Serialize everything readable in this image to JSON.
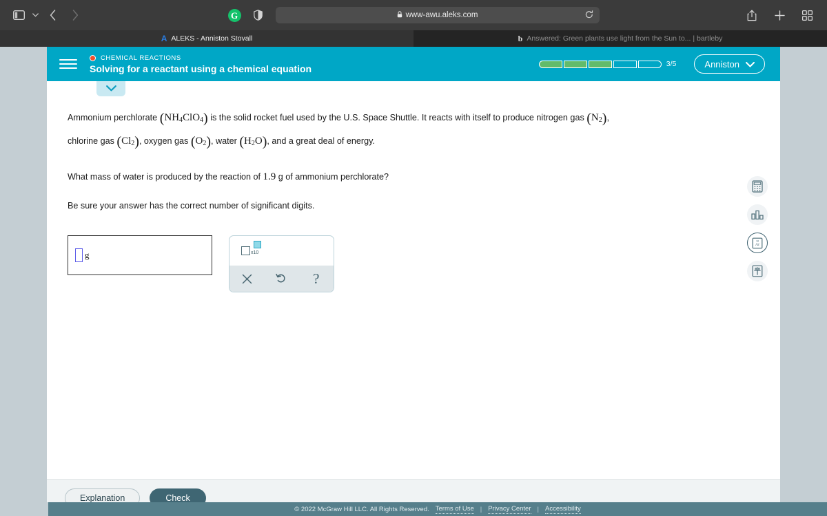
{
  "browser": {
    "url": "www-awu.aleks.com",
    "icons": {
      "sidebar": "sidebar-icon",
      "sidebar_chevron": "chevron-down-icon",
      "back": "back-arrow-icon",
      "forward": "forward-arrow-icon",
      "grammarly": "G",
      "shield": "shield-icon",
      "lock": "lock-icon",
      "reload": "reload-icon",
      "share": "share-icon",
      "new_tab": "plus-icon",
      "tab_overview": "grid-icon"
    },
    "tabs": [
      {
        "favicon": "A",
        "title": "ALEKS - Anniston Stovall",
        "active": true
      },
      {
        "favicon": "b",
        "title": "Answered: Green plants use light from the Sun to... | bartleby",
        "active": false
      }
    ]
  },
  "app_header": {
    "topic_label": "CHEMICAL REACTIONS",
    "lesson_title": "Solving for a reactant using a chemical equation",
    "progress": {
      "total": 5,
      "completed": 3,
      "count_text": "3/5"
    },
    "user_name": "Anniston",
    "user_chevron": "chevron-down-icon",
    "menu_icon": "hamburger-menu-icon",
    "collapse_icon": "chevron-down-icon",
    "accent_color": "#00a7c6",
    "topic_dot_color": "#f0502d",
    "progress_fill_color": "#62bb6a"
  },
  "question": {
    "paragraph1": {
      "part1": "Ammonium perchlorate ",
      "formula1_pre": "NH",
      "formula1_sub1": "4",
      "formula1_mid": "ClO",
      "formula1_sub2": "4",
      "part2": " is the solid rocket fuel used by the U.S. Space Shuttle. It reacts with itself to produce nitrogen gas ",
      "formula2_pre": "N",
      "formula2_sub": "2",
      "part3": ","
    },
    "paragraph2": {
      "part1": "chlorine gas ",
      "formula1_pre": "Cl",
      "formula1_sub": "2",
      "part2": ", oxygen gas ",
      "formula2_pre": "O",
      "formula2_sub": "2",
      "part3": ", water ",
      "formula3_pre": "H",
      "formula3_sub": "2",
      "formula3_post": "O",
      "part4": ", and a great deal of energy."
    },
    "paragraph3": {
      "part1": "What mass of water is produced by the reaction of ",
      "value": "1.9",
      "part2": " g of ammonium perchlorate?"
    },
    "paragraph4": "Be sure your answer has the correct number of significant digits."
  },
  "answer": {
    "input_value": "",
    "unit": "g",
    "blank_name": "answer-blank"
  },
  "math_pad": {
    "sci_notation": {
      "x10_label": "x10",
      "name": "scientific-notation-button"
    },
    "keys": [
      {
        "name": "clear-button",
        "glyph": "×"
      },
      {
        "name": "undo-button",
        "glyph": "undo-icon"
      },
      {
        "name": "help-button",
        "glyph": "?"
      }
    ]
  },
  "tool_rail": [
    {
      "name": "calculator-icon",
      "active": false
    },
    {
      "name": "bar-chart-icon",
      "active": false
    },
    {
      "name": "periodic-table-icon",
      "active": true,
      "label": "Ar",
      "superscript": "18"
    },
    {
      "name": "reference-table-icon",
      "active": false
    }
  ],
  "actions": {
    "explanation_label": "Explanation",
    "check_label": "Check"
  },
  "footer": {
    "copyright": "© 2022 McGraw Hill LLC. All Rights Reserved.",
    "links": [
      "Terms of Use",
      "Privacy Center",
      "Accessibility"
    ],
    "separator": "|"
  }
}
